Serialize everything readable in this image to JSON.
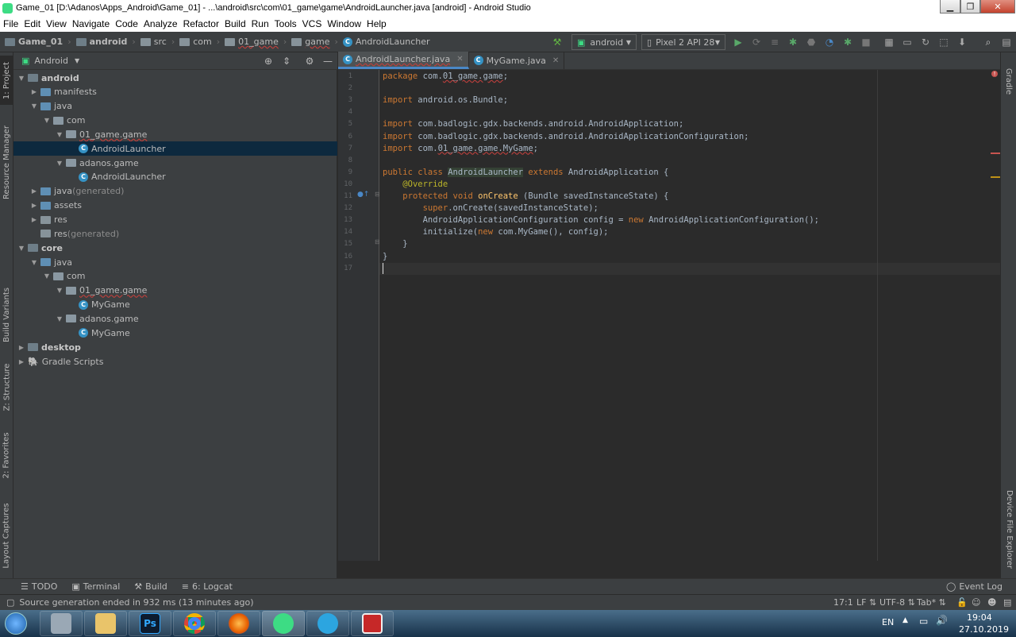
{
  "window": {
    "title": "Game_01 [D:\\Adanos\\Apps_Android\\Game_01] - ...\\android\\src\\com\\01_game\\game\\AndroidLauncher.java [android] - Android Studio"
  },
  "menu": [
    "File",
    "Edit",
    "View",
    "Navigate",
    "Code",
    "Analyze",
    "Refactor",
    "Build",
    "Run",
    "Tools",
    "VCS",
    "Window",
    "Help"
  ],
  "breadcrumb": [
    "Game_01",
    "android",
    "src",
    "com",
    "01_game",
    "game",
    "AndroidLauncher"
  ],
  "toolbar": {
    "config": "android",
    "device": "Pixel 2 API 28"
  },
  "project": {
    "view": "Android",
    "rows": [
      {
        "text": "android",
        "indent": 0,
        "arrow": "▼",
        "icon": "module",
        "bold": true
      },
      {
        "text": "manifests",
        "indent": 1,
        "arrow": "▶",
        "icon": "folder"
      },
      {
        "text": "java",
        "indent": 1,
        "arrow": "▼",
        "icon": "folder"
      },
      {
        "text": "com",
        "indent": 2,
        "arrow": "▼",
        "icon": "package"
      },
      {
        "text": "01_game.game",
        "indent": 3,
        "arrow": "▼",
        "icon": "package",
        "underline": true
      },
      {
        "text": "AndroidLauncher",
        "indent": 4,
        "arrow": "",
        "icon": "class",
        "selected": true
      },
      {
        "text": "adanos.game",
        "indent": 3,
        "arrow": "▼",
        "icon": "package"
      },
      {
        "text": "AndroidLauncher",
        "indent": 4,
        "arrow": "",
        "icon": "class"
      },
      {
        "text": "java",
        "suffix": " (generated)",
        "indent": 1,
        "arrow": "▶",
        "icon": "folder"
      },
      {
        "text": "assets",
        "indent": 1,
        "arrow": "▶",
        "icon": "folder"
      },
      {
        "text": "res",
        "indent": 1,
        "arrow": "▶",
        "icon": "folder"
      },
      {
        "text": "res",
        "suffix": " (generated)",
        "indent": 1,
        "arrow": "",
        "icon": "folder"
      },
      {
        "text": "core",
        "indent": 0,
        "arrow": "▼",
        "icon": "module",
        "bold": true
      },
      {
        "text": "java",
        "indent": 1,
        "arrow": "▼",
        "icon": "folder"
      },
      {
        "text": "com",
        "indent": 2,
        "arrow": "▼",
        "icon": "package"
      },
      {
        "text": "01_game.game",
        "indent": 3,
        "arrow": "▼",
        "icon": "package",
        "underline": true
      },
      {
        "text": "MyGame",
        "indent": 4,
        "arrow": "",
        "icon": "class"
      },
      {
        "text": "adanos.game",
        "indent": 3,
        "arrow": "▼",
        "icon": "package"
      },
      {
        "text": "MyGame",
        "indent": 4,
        "arrow": "",
        "icon": "class"
      },
      {
        "text": "desktop",
        "indent": 0,
        "arrow": "▶",
        "icon": "module",
        "bold": true
      },
      {
        "text": "Gradle Scripts",
        "indent": 0,
        "arrow": "▶",
        "icon": "gradle"
      }
    ]
  },
  "tabs": [
    {
      "label": "AndroidLauncher.java",
      "active": true
    },
    {
      "label": "MyGame.java",
      "active": false
    }
  ],
  "code": [
    [
      [
        "kw",
        "package "
      ],
      [
        "",
        "com."
      ],
      [
        "err",
        "01_game.game"
      ],
      [
        "",
        ";"
      ]
    ],
    [],
    [
      [
        "kw",
        "import "
      ],
      [
        "",
        "android.os.Bundle;"
      ]
    ],
    [],
    [
      [
        "kw",
        "import "
      ],
      [
        "",
        "com.badlogic.gdx.backends.android.AndroidApplication;"
      ]
    ],
    [
      [
        "kw",
        "import "
      ],
      [
        "",
        "com.badlogic.gdx.backends.android.AndroidApplicationConfiguration;"
      ]
    ],
    [
      [
        "kw",
        "import "
      ],
      [
        "",
        "com."
      ],
      [
        "err",
        "01_game.game.MyGame"
      ],
      [
        "",
        ";"
      ]
    ],
    [],
    [
      [
        "kw",
        "public class "
      ],
      [
        "hl",
        "AndroidLauncher"
      ],
      [
        "kw",
        " extends "
      ],
      [
        "",
        "AndroidApplication {"
      ]
    ],
    [
      [
        "",
        "    "
      ],
      [
        "an",
        "@Override"
      ]
    ],
    [
      [
        "",
        "    "
      ],
      [
        "kw",
        "protected void "
      ],
      [
        "fn",
        "onCreate "
      ],
      [
        "",
        "(Bundle savedInstanceState) {"
      ]
    ],
    [
      [
        "",
        "        "
      ],
      [
        "kw",
        "super"
      ],
      [
        "",
        ".onCreate(savedInstanceState);"
      ]
    ],
    [
      [
        "",
        "        AndroidApplicationConfiguration config = "
      ],
      [
        "kw",
        "new "
      ],
      [
        "",
        "AndroidApplicationConfiguration();"
      ]
    ],
    [
      [
        "",
        "        initialize("
      ],
      [
        "kw",
        "new "
      ],
      [
        "",
        "com.MyGame(), config);"
      ]
    ],
    [
      [
        "",
        "    }"
      ]
    ],
    [
      [
        "",
        "}"
      ]
    ],
    []
  ],
  "left_tabs": [
    "1: Project",
    "Resource Manager",
    "Build Variants",
    "Z: Structure",
    "2: Favorites",
    "Layout Captures"
  ],
  "right_tabs": [
    "Gradle",
    "Device File Explorer"
  ],
  "tool_windows": [
    "TODO",
    "Terminal",
    "Build",
    "6: Logcat"
  ],
  "event_log": "Event Log",
  "status": {
    "message": "Source generation ended in 932 ms (13 minutes ago)",
    "position": "17:1",
    "line_sep": "LF",
    "encoding": "UTF-8",
    "indent": "Tab*"
  },
  "taskbar": {
    "lang": "EN",
    "time": "19:04",
    "date": "27.10.2019"
  }
}
